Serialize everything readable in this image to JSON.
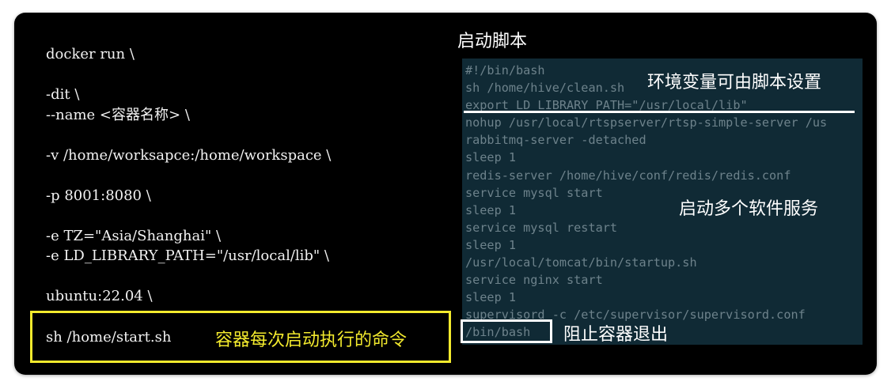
{
  "docker_command": {
    "lines": [
      "docker run \\",
      "",
      "-dit \\",
      "--name <容器名称> \\",
      "",
      "-v /home/worksapce:/home/workspace \\",
      "",
      "-p 8001:8080 \\",
      "",
      "-e TZ=\"Asia/Shanghai\" \\",
      "-e LD_LIBRARY_PATH=\"/usr/local/lib\" \\",
      "",
      "ubuntu:22.04 \\"
    ],
    "final_command": "sh /home/start.sh",
    "final_command_note": "容器每次启动执行的命令",
    "highlight_color": "#f3ea2d"
  },
  "startup_script": {
    "title": "启动脚本",
    "panel_color": "#102a35",
    "lines": [
      "#!/bin/bash",
      "sh /home/hive/clean.sh",
      "export LD_LIBRARY_PATH=\"/usr/local/lib\"",
      "nohup /usr/local/rtspserver/rtsp-simple-server /us",
      "rabbitmq-server -detached",
      "sleep 1",
      "redis-server /home/hive/conf/redis/redis.conf",
      "service mysql start",
      "sleep 1",
      "service mysql restart",
      "sleep 1",
      "/usr/local/tomcat/bin/startup.sh",
      "service nginx start",
      "sleep 1",
      "supervisord -c /etc/supervisor/supervisord.conf",
      "/bin/bash"
    ],
    "annotations": {
      "env": "环境变量可由脚本设置",
      "services": "启动多个软件服务",
      "keep_alive": "阻止容器退出"
    }
  }
}
